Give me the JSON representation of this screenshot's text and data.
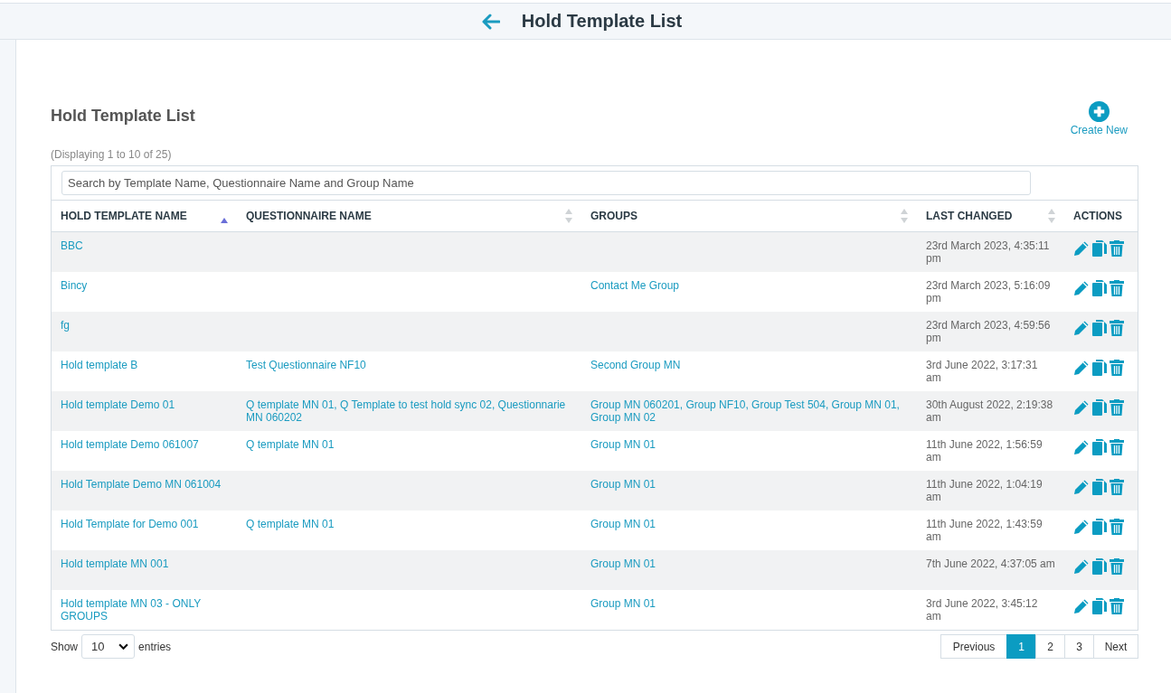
{
  "header": {
    "title": "Hold Template List"
  },
  "page": {
    "title": "Hold Template List",
    "create_label": "Create New",
    "summary": "(Displaying 1 to 10 of 25)"
  },
  "search": {
    "placeholder": "Search by Template Name, Questionnaire Name and Group Name"
  },
  "table": {
    "columns": [
      {
        "label": "HOLD TEMPLATE NAME",
        "sorted": true
      },
      {
        "label": "QUESTIONNAIRE NAME",
        "sorted": false
      },
      {
        "label": "GROUPS",
        "sorted": false
      },
      {
        "label": "LAST CHANGED",
        "sorted": false
      },
      {
        "label": "ACTIONS"
      }
    ],
    "rows": [
      {
        "name": "BBC",
        "changed": "23rd March 2023, 4:35:11 pm"
      },
      {
        "name": "Bincy",
        "groups": "Contact Me Group",
        "changed": "23rd March 2023, 5:16:09 pm"
      },
      {
        "name": "fg",
        "changed": "23rd March 2023, 4:59:56 pm"
      },
      {
        "name": "Hold template B",
        "questionnaire": "Test Questionnaire NF10",
        "groups": "Second Group MN",
        "changed": "3rd June 2022, 3:17:31 am"
      },
      {
        "name": "Hold template Demo 01",
        "questionnaire": "Q template MN 01, Q Template to test hold sync 02, Questionnarie MN 060202",
        "groups": "Group MN 060201, Group NF10, Group Test 504, Group MN 01, Group MN 02",
        "changed": "30th August 2022, 2:19:38 am"
      },
      {
        "name": "Hold template Demo 061007",
        "questionnaire": "Q template MN 01",
        "groups": "Group MN 01",
        "changed": "11th June 2022, 1:56:59 am"
      },
      {
        "name": "Hold Template Demo MN 061004",
        "groups": "Group MN 01",
        "changed": "11th June 2022, 1:04:19 am"
      },
      {
        "name": "Hold Template for Demo 001",
        "questionnaire": "Q template MN 01",
        "groups": "Group MN 01",
        "changed": "11th June 2022, 1:43:59 am"
      },
      {
        "name": "Hold template MN 001",
        "groups": "Group MN 01",
        "changed": "7th June 2022, 4:37:05 am"
      },
      {
        "name": "Hold template MN 03 - ONLY GROUPS",
        "groups": "Group MN 01",
        "changed": "3rd June 2022, 3:45:12 am"
      }
    ]
  },
  "footer": {
    "show_label": "Show",
    "page_size": "10",
    "entries_label": "entries"
  },
  "pagination": {
    "previous": "Previous",
    "next": "Next",
    "pages": [
      {
        "label": "1",
        "selected": true
      },
      {
        "label": "2",
        "selected": false
      },
      {
        "label": "3",
        "selected": false
      }
    ]
  }
}
